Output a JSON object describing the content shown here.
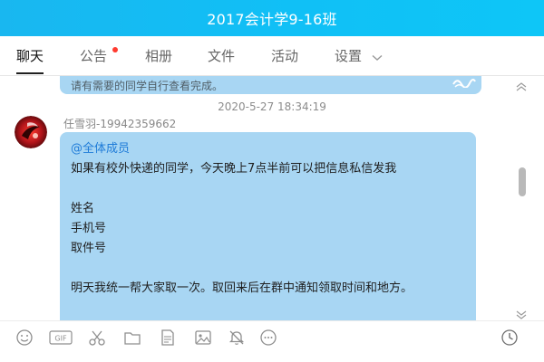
{
  "window": {
    "title": "2017会计学9-16班"
  },
  "tabs": [
    {
      "label": "聊天",
      "active": true
    },
    {
      "label": "公告",
      "has_notification": true
    },
    {
      "label": "相册"
    },
    {
      "label": "文件"
    },
    {
      "label": "活动"
    },
    {
      "label": "设置"
    }
  ],
  "chat": {
    "previous_message_fragment": "请有需要的同学自行查看完成。",
    "timestamp": "2020-5-27 18:34:19",
    "message": {
      "sender": "任雪羽-19942359662",
      "lines": [
        "@全体成员",
        "如果有校外快递的同学，今天晚上7点半前可以把信息私信发我",
        "",
        "姓名",
        "手机号",
        "取件号",
        "",
        "明天我统一帮大家取一次。取回来后在群中通知领取时间和地方。"
      ]
    }
  },
  "toolbar": {
    "icons": [
      "emoji-icon",
      "gif-icon",
      "scissors-icon",
      "folder-icon",
      "document-icon",
      "image-icon",
      "mute-bell-icon",
      "more-icon",
      "history-clock-icon"
    ],
    "gif_label": "GIF"
  },
  "colors": {
    "title_bar": "#10c0f6",
    "bubble": "#a8d6f3",
    "mention": "#1e7bd8",
    "notification_dot": "#ff3b30"
  }
}
